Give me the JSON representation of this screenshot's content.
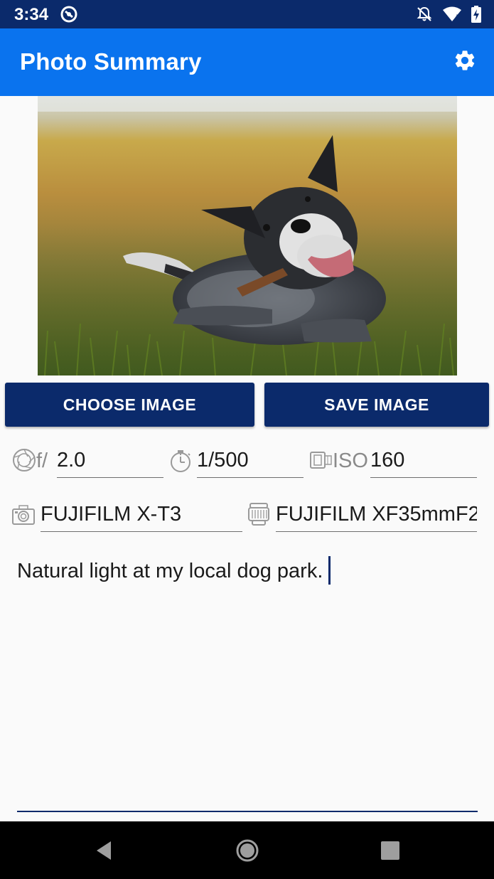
{
  "status_bar": {
    "time": "3:34",
    "icons": [
      "data-saver-icon",
      "notifications-off-icon",
      "wifi-icon",
      "battery-charging-icon"
    ]
  },
  "app_bar": {
    "title": "Photo Summary",
    "settings_icon": "gear-icon"
  },
  "photo": {
    "subject": "dog-with-stick-photo"
  },
  "buttons": {
    "choose_label": "CHOOSE IMAGE",
    "save_label": "SAVE IMAGE"
  },
  "exif": {
    "aperture": {
      "icon": "aperture-icon",
      "prefix": "f/",
      "value": "2.0"
    },
    "shutter": {
      "icon": "stopwatch-icon",
      "value": "1/500"
    },
    "iso": {
      "icon": "film-icon",
      "prefix": "ISO",
      "value": "160"
    },
    "camera": {
      "icon": "camera-icon",
      "value": "FUJIFILM X-T3"
    },
    "lens": {
      "icon": "lens-icon",
      "value": "FUJIFILM XF35mmF2"
    }
  },
  "notes": {
    "text": "Natural light at my local dog park."
  },
  "nav_bar": {
    "icons": [
      "back-icon",
      "home-icon",
      "recents-icon"
    ]
  },
  "colors": {
    "status_bar": "#0b2a6b",
    "app_bar": "#0a73ee",
    "button": "#0b2a6b",
    "background": "#fafafa",
    "nav_bar": "#000000"
  }
}
